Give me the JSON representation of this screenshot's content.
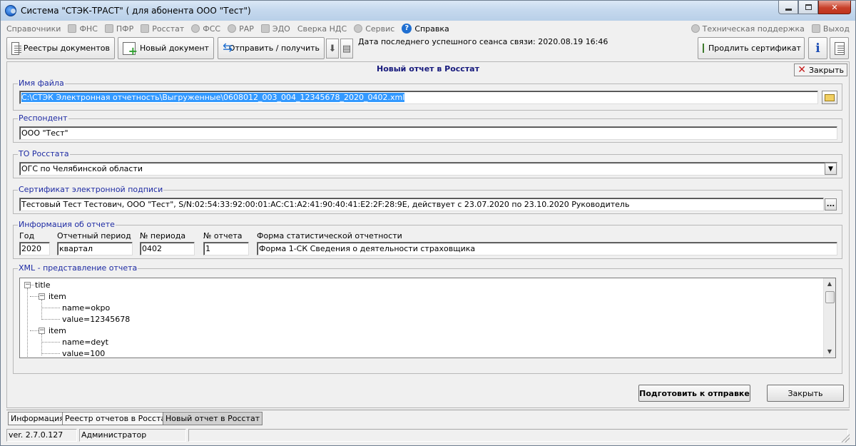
{
  "window": {
    "title": "Система \"СТЭК-ТРАСТ\" ( для абонента ООО \"Тест\")"
  },
  "menu": {
    "items": [
      {
        "label": "Справочники",
        "icon": null
      },
      {
        "label": "ФНС",
        "icon": "fns-icon"
      },
      {
        "label": "ПФР",
        "icon": "pfr-icon"
      },
      {
        "label": "Росстат",
        "icon": "rosstat-icon"
      },
      {
        "label": "ФСС",
        "icon": "fss-icon"
      },
      {
        "label": "РАР",
        "icon": "rar-icon"
      },
      {
        "label": "ЭДО",
        "icon": "edo-icon"
      },
      {
        "label": "Сверка НДС",
        "icon": null
      },
      {
        "label": "Сервис",
        "icon": "gear-icon"
      },
      {
        "label": "Справка",
        "icon": "help-icon"
      }
    ],
    "support": "Техническая поддержка",
    "exit": "Выход"
  },
  "toolbar": {
    "registers": "Реестры документов",
    "new_doc": "Новый документ",
    "send_receive": "Отправить / получить",
    "status": "Дата последнего успешного сеанса связи: 2020.08.19 16:46",
    "renew_cert": "Продлить сертификат",
    "info_glyph": "i"
  },
  "form": {
    "title": "Новый отчет в Росстат",
    "close_top": "Закрыть",
    "file_group": {
      "label": "Имя файла",
      "value": "C:\\СТЭК Электронная отчетность\\Выгруженные\\0608012_003_004_12345678_2020_0402.xml"
    },
    "respondent_group": {
      "label": "Респондент",
      "value": "ООО \"Тест\""
    },
    "to_group": {
      "label": "ТО Росстата",
      "value": "ОГС по Челябинской области"
    },
    "cert_group": {
      "label": "Сертификат электронной подписи",
      "value": "Тестовый Тест Тестович, ООО \"Тест\", S/N:02:54:33:92:00:01:AC:C1:A2:41:90:40:41:E2:2F:28:9E, действует с 23.07.2020 по 23.10.2020 Руководитель",
      "browse": "..."
    },
    "info_group": {
      "label": "Информация об отчете",
      "year_label": "Год",
      "year": "2020",
      "period_label": "Отчетный период",
      "period": "квартал",
      "period_no_label": "№ периода",
      "period_no": "0402",
      "report_no_label": "№ отчета",
      "report_no": "1",
      "form_label": "Форма статистической отчетности",
      "form": "Форма 1-СК Сведения о деятельности страховщика"
    },
    "xml_group": {
      "label": "XML - представление отчета",
      "tree": [
        "title",
        "item",
        "name=okpo",
        "value=12345678",
        "item",
        "name=deyt",
        "value=100"
      ]
    },
    "prepare_button": "Подготовить к отправке",
    "close_button": "Закрыть"
  },
  "tabs": [
    "Информация",
    "Реестр отчетов в Росстат",
    "Новый отчет в Росстат"
  ],
  "statusbar": {
    "version": "ver. 2.7.0.127",
    "user": "Администратор"
  }
}
